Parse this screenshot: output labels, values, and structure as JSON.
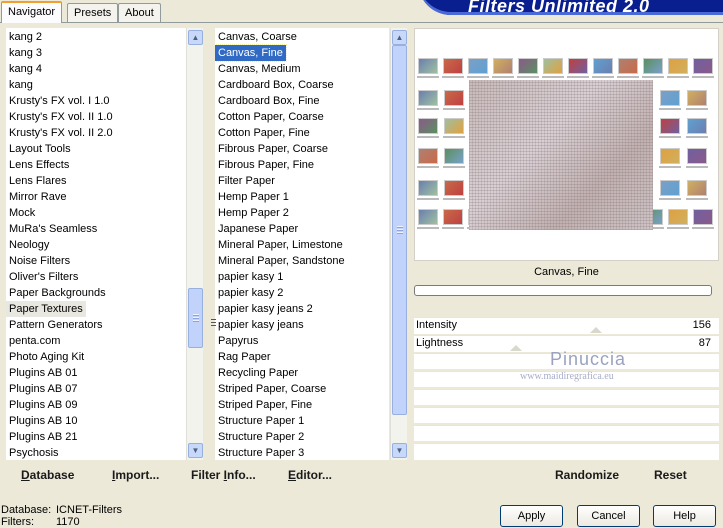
{
  "banner": {
    "title": "Filters Unlimited 2.0"
  },
  "tabs": [
    {
      "label": "Navigator",
      "active": true
    },
    {
      "label": "Presets",
      "active": false
    },
    {
      "label": "About",
      "active": false
    }
  ],
  "categories": {
    "items": [
      "kang 2",
      "kang 3",
      "kang 4",
      "kang",
      "Krusty's FX vol. I 1.0",
      "Krusty's FX vol. II 1.0",
      "Krusty's FX vol. II 2.0",
      "Layout Tools",
      "Lens Effects",
      "Lens Flares",
      "Mirror Rave",
      "Mock",
      "MuRa's Seamless",
      "Neology",
      "Noise Filters",
      "Oliver's Filters",
      "Paper Backgrounds",
      "Paper Textures",
      "Pattern Generators",
      "penta.com",
      "Photo Aging Kit",
      "Plugins AB 01",
      "Plugins AB 07",
      "Plugins AB 09",
      "Plugins AB 10",
      "Plugins AB 21",
      "Psychosis"
    ],
    "selected": "Paper Textures"
  },
  "filters": {
    "items": [
      "Canvas, Coarse",
      "Canvas, Fine",
      "Canvas, Medium",
      "Cardboard Box, Coarse",
      "Cardboard Box, Fine",
      "Cotton Paper, Coarse",
      "Cotton Paper, Fine",
      "Fibrous Paper, Coarse",
      "Fibrous Paper, Fine",
      "Filter Paper",
      "Hemp Paper 1",
      "Hemp Paper 2",
      "Japanese Paper",
      "Mineral Paper, Limestone",
      "Mineral Paper, Sandstone",
      "papier kasy 1",
      "papier kasy 2",
      "papier kasy jeans 2",
      "papier kasy jeans",
      "Papyrus",
      "Rag Paper",
      "Recycling Paper",
      "Striped Paper, Coarse",
      "Striped Paper, Fine",
      "Structure Paper 1",
      "Structure Paper 2",
      "Structure Paper 3"
    ],
    "selected": "Canvas, Fine"
  },
  "preview": {
    "filter_name": "Canvas, Fine"
  },
  "sliders": [
    {
      "label": "Intensity",
      "value": "156"
    },
    {
      "label": "Lightness",
      "value": "87"
    }
  ],
  "watermark": {
    "line1": "Pinuccia",
    "line2": "www.maidiregrafica.eu"
  },
  "toolbar": {
    "database": {
      "u": "D",
      "rest": "atabase"
    },
    "import": {
      "u": "I",
      "rest": "mport..."
    },
    "filter_info": {
      "pre": "Filter ",
      "u": "I",
      "rest": "nfo..."
    },
    "editor": {
      "u": "E",
      "rest": "ditor..."
    },
    "randomize": "Randomize",
    "reset": "Reset"
  },
  "status": {
    "database_label": "Database:",
    "database_value": "ICNET-Filters",
    "filters_label": "Filters:",
    "filters_value": "1170"
  },
  "buttons": {
    "apply": "Apply",
    "cancel": "Cancel",
    "help": "Help"
  },
  "colors": {
    "selection": "#316ac5",
    "banner": "#0a1f8f",
    "tab_accent": "#f0a030"
  }
}
